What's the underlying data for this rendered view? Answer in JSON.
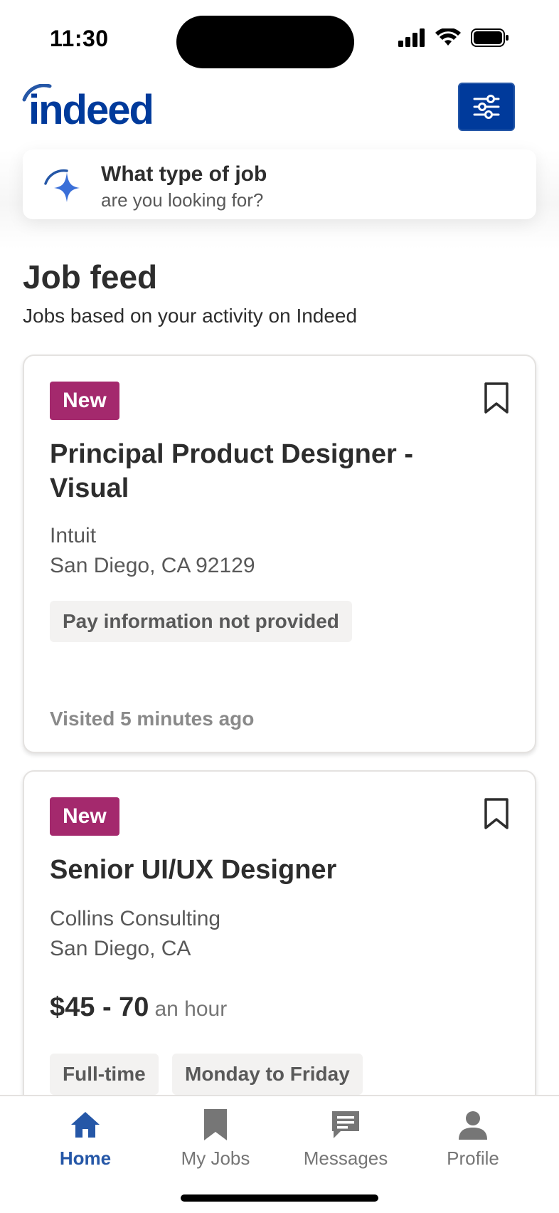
{
  "status_bar": {
    "time": "11:30"
  },
  "header": {
    "logo_text": "indeed",
    "filter_icon": "sliders-icon"
  },
  "search": {
    "title": "What type of job",
    "subtitle": "are you looking for?",
    "icon": "sparkle-icon"
  },
  "feed": {
    "title": "Job feed",
    "subtitle": "Jobs based on your activity on Indeed"
  },
  "jobs": [
    {
      "badge": "New",
      "title": "Principal Product Designer - Visual",
      "company": "Intuit",
      "location": "San Diego, CA 92129",
      "chips": [
        "Pay information not provided"
      ],
      "visited": "Visited 5 minutes ago"
    },
    {
      "badge": "New",
      "title": "Senior UI/UX Designer",
      "company": "Collins Consulting",
      "location": "San Diego, CA",
      "pay": "$45 - 70",
      "pay_unit": "an hour",
      "chips": [
        "Full-time",
        "Monday to Friday"
      ]
    }
  ],
  "nav": [
    {
      "label": "Home",
      "icon": "home-icon",
      "active": true
    },
    {
      "label": "My Jobs",
      "icon": "bookmark-icon",
      "active": false
    },
    {
      "label": "Messages",
      "icon": "message-icon",
      "active": false
    },
    {
      "label": "Profile",
      "icon": "profile-icon",
      "active": false
    }
  ],
  "colors": {
    "brand_blue": "#2557a7",
    "filter_button": "#003a9b",
    "new_badge": "#a4296d",
    "chip_bg": "#f3f2f1"
  }
}
